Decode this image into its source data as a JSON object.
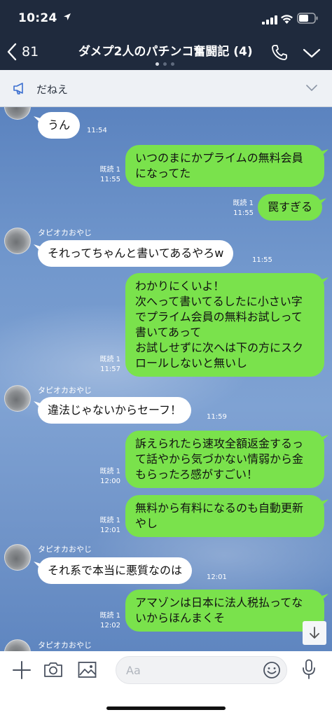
{
  "status_bar": {
    "time": "10:24"
  },
  "header": {
    "back_count": "81",
    "title": "ダメプ2人のパチンコ奮闘記 (4)"
  },
  "announcement": {
    "text": "だねえ"
  },
  "messages": [
    {
      "type": "in",
      "text": "うん",
      "time": "11:54"
    },
    {
      "type": "out",
      "lines": [
        "いつのまにかプライムの無料会員",
        "になってた"
      ],
      "read": "既読 1",
      "time": "11:55"
    },
    {
      "type": "out",
      "text": "罠すぎる",
      "read": "既読 1",
      "time": "11:55"
    },
    {
      "type": "in",
      "sender": "タピオカおやじ",
      "text": "それってちゃんと書いてあるやろw",
      "time": "11:55"
    },
    {
      "type": "out",
      "lines": [
        "わかりにくいよ！",
        "次へって書いてるしたに小さい字",
        "でプライム会員の無料お試しって",
        "書いてあって",
        "お試しせずに次へは下の方にスク",
        "ロールしないと無いし"
      ],
      "read": "既読 1",
      "time": "11:57"
    },
    {
      "type": "in",
      "sender": "タピオカおやじ",
      "text": "違法じゃないからセーフ！",
      "time": "11:59"
    },
    {
      "type": "out",
      "lines": [
        "訴えられたら速攻全額返金するっ",
        "て話やから気づかない情弱から金",
        "もらったろ感がすごい！"
      ],
      "read": "既読 1",
      "time": "12:00"
    },
    {
      "type": "out",
      "lines": [
        "無料から有料になるのも自動更新",
        "やし"
      ],
      "read": "既読 1",
      "time": "12:01"
    },
    {
      "type": "in",
      "sender": "タピオカおやじ",
      "text": "それ系で本当に悪質なのは",
      "time": "12:01"
    },
    {
      "type": "out",
      "lines": [
        "アマゾンは日本に法人税払ってな",
        "いからほんまくそ"
      ],
      "read": "既読 1",
      "time": "12:02"
    },
    {
      "type": "in",
      "sender": "タピオカおやじ"
    }
  ],
  "input": {
    "placeholder": "Aa"
  },
  "colors": {
    "header_bg": "#1f2a3d",
    "outgoing_bubble": "#7ae24c",
    "incoming_bubble": "#ffffff",
    "chat_bg": "#7298cd"
  },
  "icons": [
    "location-arrow-icon",
    "signal-icon",
    "wifi-icon",
    "battery-icon",
    "back-chevron-icon",
    "phone-icon",
    "chevron-down-icon",
    "megaphone-icon",
    "arrow-down-icon",
    "plus-icon",
    "camera-icon",
    "image-icon",
    "emoji-icon",
    "microphone-icon"
  ]
}
